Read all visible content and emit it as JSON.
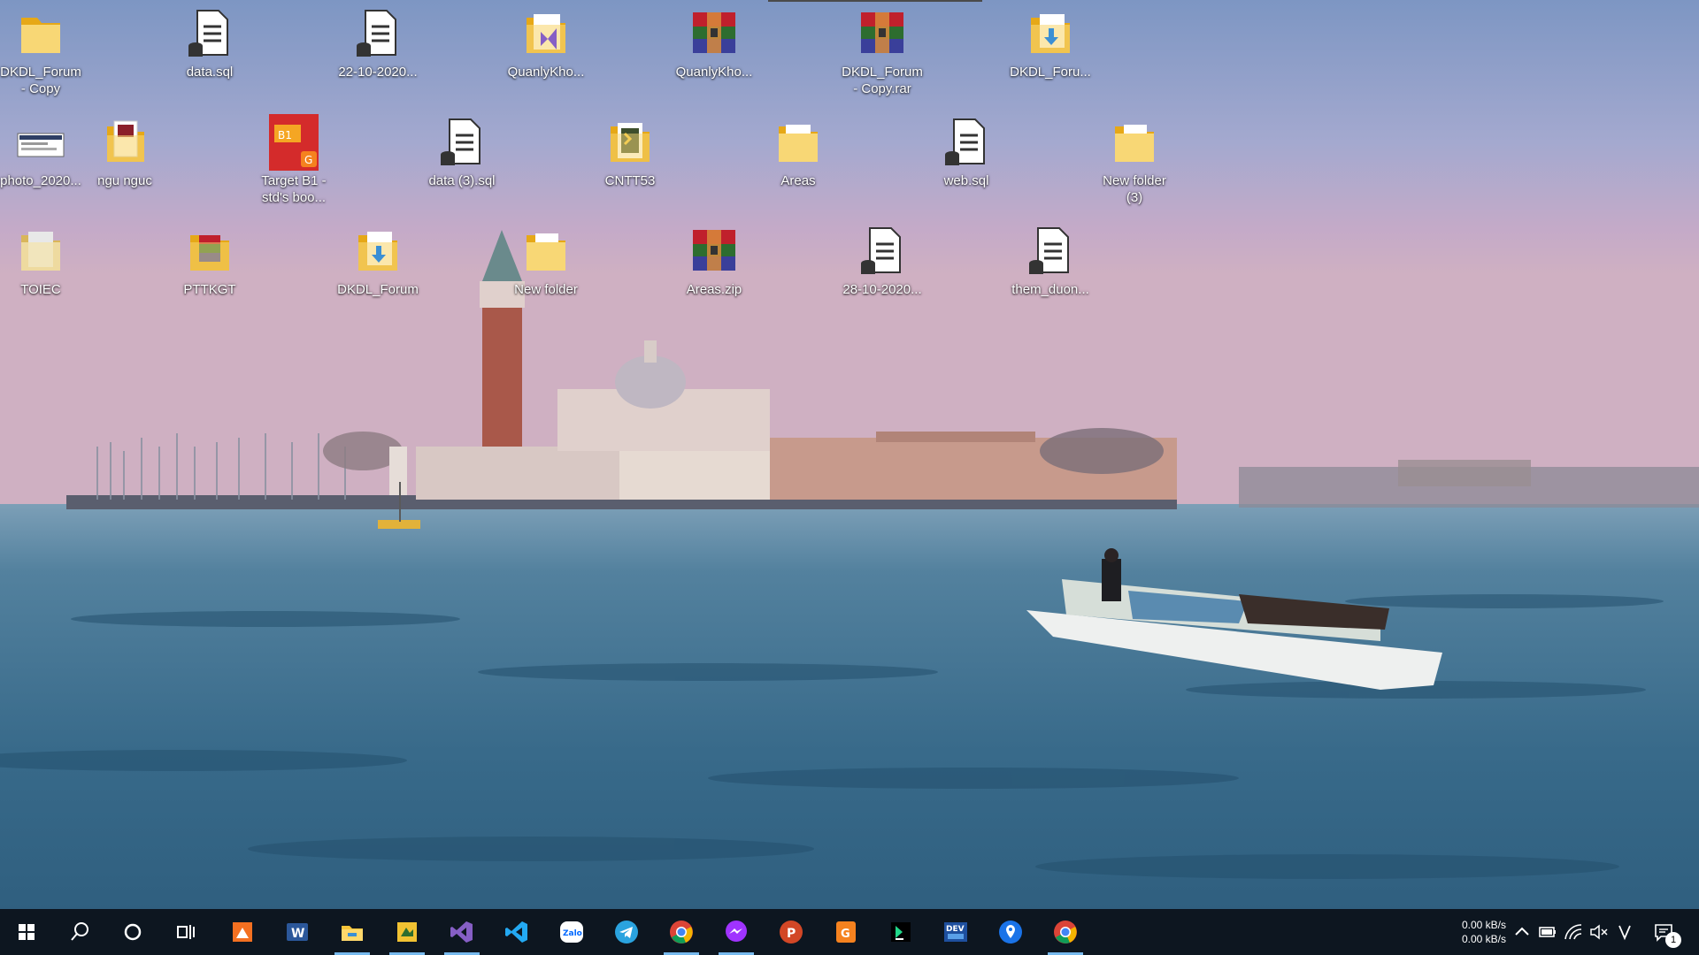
{
  "desktop": {
    "icons": [
      {
        "label": "DKDL_Forum\n- Copy",
        "type": "folder"
      },
      {
        "label": "data.sql",
        "type": "sql"
      },
      {
        "label": "22-10-2020...",
        "type": "sql"
      },
      {
        "label": "QuanlyKho...",
        "type": "vs-folder"
      },
      {
        "label": "QuanlyKho...",
        "type": "rar"
      },
      {
        "label": "DKDL_Forum\n- Copy.rar",
        "type": "rar"
      },
      {
        "label": "DKDL_Foru...",
        "type": "folder-doc"
      },
      {
        "label": "photo_2020...",
        "type": "photo"
      },
      {
        "label": "ngu nguc",
        "type": "folder-pages"
      },
      {
        "label": "Target B1 -\nstd's boo...",
        "type": "pdf-book"
      },
      {
        "label": "data (3).sql",
        "type": "sql"
      },
      {
        "label": "CNTT53",
        "type": "folder-code"
      },
      {
        "label": "Areas",
        "type": "folder"
      },
      {
        "label": "web.sql",
        "type": "sql"
      },
      {
        "label": "New folder\n(3)",
        "type": "folder"
      },
      {
        "label": "TOIEC",
        "type": "folder-gray"
      },
      {
        "label": "PTTKGT",
        "type": "folder-rar"
      },
      {
        "label": "DKDL_Forum",
        "type": "folder-doc"
      },
      {
        "label": "New folder",
        "type": "folder"
      },
      {
        "label": "Areas.zip",
        "type": "rar"
      },
      {
        "label": "28-10-2020...",
        "type": "sql"
      },
      {
        "label": "them_duon...",
        "type": "sql"
      }
    ]
  },
  "taskbar": {
    "start": "windows-start-icon",
    "search": "search-icon",
    "cortana": "cortana-icon",
    "taskview": "task-view-icon",
    "apps": [
      {
        "name": "sublime-like-orange-app-icon",
        "color": "#f37021"
      },
      {
        "name": "word-icon",
        "color": "#2b579a",
        "text": "W"
      },
      {
        "name": "file-explorer-icon",
        "color": "#f8c53a"
      },
      {
        "name": "code-folder-icon",
        "color": "#f1c232"
      },
      {
        "name": "visual-studio-icon",
        "color": "#865fc5"
      },
      {
        "name": "vscode-icon",
        "color": "#23a9f2"
      },
      {
        "name": "zalo-icon",
        "color": "#0068ff",
        "text": "Zalo"
      },
      {
        "name": "telegram-icon",
        "color": "#2aa3df"
      },
      {
        "name": "chrome-icon",
        "color": "#db4437"
      },
      {
        "name": "messenger-icon",
        "color": "#a033ff"
      },
      {
        "name": "powerpoint-icon",
        "color": "#d24726",
        "text": "P"
      },
      {
        "name": "foxit-pdf-icon",
        "color": "#f5821f"
      },
      {
        "name": "pycharm-icon",
        "color": "#21d789"
      },
      {
        "name": "dev-cpp-icon",
        "color": "#1e4f9e",
        "text": "DEV"
      },
      {
        "name": "maps-pin-icon",
        "color": "#1a73e8"
      },
      {
        "name": "chrome-icon",
        "color": "#db4437"
      }
    ],
    "tray": {
      "upload_speed": "0.00 kB/s",
      "download_speed": "0.00 kB/s",
      "notification_count": "1"
    }
  }
}
